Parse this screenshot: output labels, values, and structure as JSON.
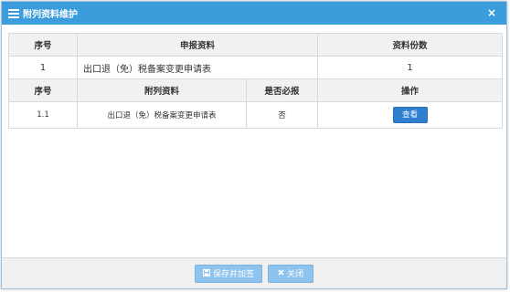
{
  "dialog": {
    "title": "附列资料维护",
    "close_glyph": "×"
  },
  "table": {
    "main_headers": [
      "序号",
      "申报资料",
      "资料份数"
    ],
    "main_row": {
      "index": "1",
      "name": "出口退（免）税备案变更申请表",
      "copies": "1"
    },
    "sub_headers": [
      "序号",
      "附列资料",
      "是否必报",
      "操作"
    ],
    "sub_rows": [
      {
        "index": "1.1",
        "name": "出口退（免）税备案变更申请表",
        "required": "否",
        "action": "查看"
      }
    ]
  },
  "footer": {
    "save_label": "保存并加签",
    "close_label": "关闭",
    "save_icon": "save-icon",
    "close_icon": "close-icon"
  },
  "colors": {
    "titlebar": "#3c9ddc",
    "view_button": "#2f7fd0",
    "footer_button": "#8ec3ee"
  }
}
